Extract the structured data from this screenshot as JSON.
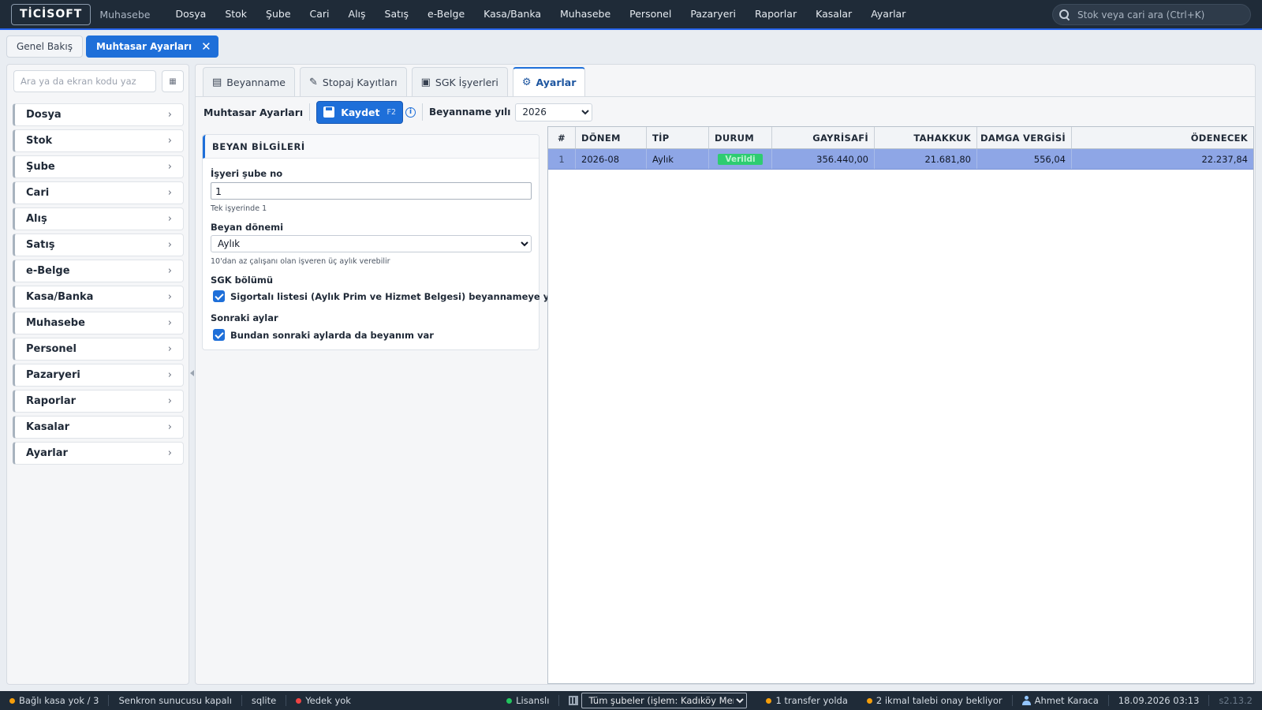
{
  "app": {
    "logo": "TİCİSOFT",
    "name": "Muhasebe"
  },
  "menu": [
    "Dosya",
    "Stok",
    "Şube",
    "Cari",
    "Alış",
    "Satış",
    "e-Belge",
    "Kasa/Banka",
    "Muhasebe",
    "Personel",
    "Pazaryeri",
    "Raporlar",
    "Kasalar",
    "Ayarlar"
  ],
  "global_search": {
    "placeholder": "Stok veya cari ara (Ctrl+K)"
  },
  "doc_tabs": {
    "overview": "Genel Bakış",
    "active": "Muhtasar Ayarları",
    "close_glyph": "✕"
  },
  "sidebar": {
    "search_placeholder": "Ara ya da ekran kodu yaz",
    "grid_glyph": "▦",
    "items": [
      {
        "label": "Dosya"
      },
      {
        "label": "Stok"
      },
      {
        "label": "Şube"
      },
      {
        "label": "Cari"
      },
      {
        "label": "Alış"
      },
      {
        "label": "Satış"
      },
      {
        "label": "e-Belge"
      },
      {
        "label": "Kasa/Banka"
      },
      {
        "label": "Muhasebe"
      },
      {
        "label": "Personel"
      },
      {
        "label": "Pazaryeri"
      },
      {
        "label": "Raporlar"
      },
      {
        "label": "Kasalar"
      },
      {
        "label": "Ayarlar"
      }
    ],
    "chevron": "›"
  },
  "panel_tabs": [
    {
      "label": "Beyanname",
      "icon": "calendar-icon",
      "glyph": "▤"
    },
    {
      "label": "Stopaj Kayıtları",
      "icon": "money-icon",
      "glyph": "✎"
    },
    {
      "label": "SGK İşyerleri",
      "icon": "monitor-icon",
      "glyph": "▣"
    },
    {
      "label": "Ayarlar",
      "icon": "gear-icon",
      "glyph": "⚙"
    }
  ],
  "toolbar": {
    "title": "Muhtasar Ayarları",
    "save_label": "Kaydet",
    "save_shortcut": "F2",
    "info_glyph": "i",
    "year_label": "Beyanname yılı",
    "year_value": "2026"
  },
  "form": {
    "section_title": "BEYAN BİLGİLERİ",
    "branch_label": "İşyeri şube no",
    "branch_value": "1",
    "branch_help": "Tek işyerinde 1",
    "period_label": "Beyan dönemi",
    "period_value": "Aylık",
    "period_help": "10'dan az çalışanı olan işveren üç aylık verebilir",
    "sgk_label": "SGK bölümü",
    "sgk_check": "Sigortalı listesi (Aylık Prim ve Hizmet Belgesi) beyannameye yazılsın",
    "next_label": "Sonraki aylar",
    "next_check": "Bundan sonraki aylarda da beyanım var"
  },
  "grid": {
    "headers": {
      "num": "#",
      "donem": "DÖNEM",
      "tip": "TİP",
      "durum": "DURUM",
      "gayrisafi": "GAYRİSAFİ",
      "tahakkuk": "TAHAKKUK",
      "damga": "DAMGA VERGİSİ",
      "odenecek": "ÖDENECEK"
    },
    "rows": [
      {
        "num": "1",
        "donem": "2026-08",
        "tip": "Aylık",
        "durum": "Verildi",
        "gayrisafi": "356.440,00",
        "tahakkuk": "21.681,80",
        "damga": "556,04",
        "odenecek": "22.237,84"
      }
    ]
  },
  "statusbar": {
    "cash": "Bağlı kasa yok / 3",
    "sync": "Senkron sunucusu kapalı",
    "db": "sqlite",
    "backup": "Yedek yok",
    "license": "Lisanslı",
    "branch": "Tüm şubeler (işlem: Kadıköy Merkez)",
    "transfer": "1 transfer yolda",
    "requests": "2 ikmal talebi onay bekliyor",
    "user": "Ahmet Karaca",
    "datetime": "18.09.2026 03:13",
    "version": "s2.13.2"
  },
  "colors": {
    "accent": "#1e6fd9",
    "topbar": "#1f2b38",
    "selected_row": "#8ea6e6",
    "status_ok": "#2ecc71"
  }
}
